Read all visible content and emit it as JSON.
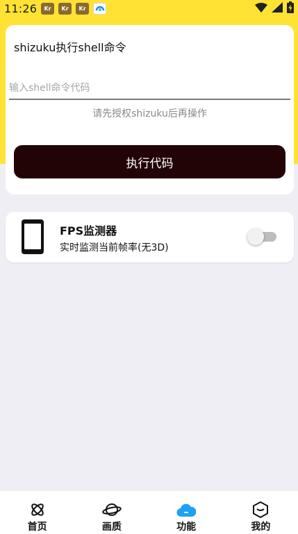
{
  "status_bar": {
    "time": "11:26",
    "notification_icons": [
      "app-notification-icon",
      "app-notification-icon",
      "app-notification-icon",
      "browser-notification-icon"
    ],
    "notification_text": "Kr",
    "right_icons": [
      "wifi-icon",
      "signal-icon",
      "battery-charging-icon"
    ]
  },
  "shell_card": {
    "title": "shizuku执行shell命令",
    "input_placeholder": "输入shell命令代码",
    "input_value": "",
    "hint": "请先授权shizuku后再操作",
    "execute_label": "执行代码"
  },
  "fps_card": {
    "title": "FPS监测器",
    "subtitle": "实时监测当前帧率(无3D)",
    "toggle_on": false
  },
  "bottom_nav": {
    "items": [
      {
        "label": "首页",
        "icon": "atom-icon",
        "active": false
      },
      {
        "label": "画质",
        "icon": "planet-icon",
        "active": false
      },
      {
        "label": "功能",
        "icon": "cloud-icon",
        "active": true
      },
      {
        "label": "我的",
        "icon": "cube-icon",
        "active": false
      }
    ]
  },
  "colors": {
    "header_yellow": "#ffe234",
    "button_dark": "#220406",
    "active_blue": "#1da1f2",
    "background": "#efeef4"
  }
}
